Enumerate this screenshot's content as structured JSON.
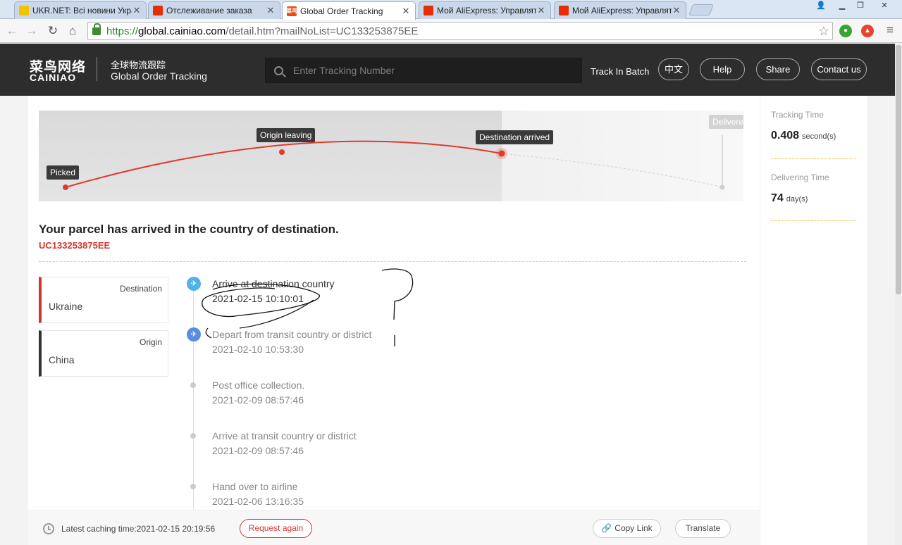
{
  "browser": {
    "tabs": [
      {
        "label": "UKR.NET: Всі новини Україн",
        "favicon_color": "#f4c300",
        "active": false
      },
      {
        "label": "Отслеживание заказа",
        "favicon_color": "#e62e04",
        "active": false
      },
      {
        "label": "Global Order Tracking",
        "favicon_color": "#e64a19",
        "favicon_text": "菜鸟",
        "active": true
      },
      {
        "label": "Мой AliExpress: Управлять",
        "favicon_color": "#e62e04",
        "active": false
      },
      {
        "label": "Мой AliExpress: Управлять",
        "favicon_color": "#e62e04",
        "active": false
      }
    ],
    "url_scheme": "https://",
    "url_host": "global.cainiao.com",
    "url_rest": "/detail.htm?mailNoList=UC133253875EE"
  },
  "header": {
    "logo_cn": "菜鸟网络",
    "logo_en": "CAINIAO",
    "subtitle_cn": "全球物流跟踪",
    "subtitle_en": "Global Order Tracking",
    "search_placeholder": "Enter Tracking Number",
    "track_in_batch": "Track In Batch",
    "lang_button": "中文",
    "help_button": "Help",
    "share_button": "Share",
    "contact_button": "Contact us"
  },
  "progress": {
    "stages": [
      "Picked",
      "Origin leaving",
      "Destination arrived",
      "Delivere"
    ],
    "current_stage": "Destination arrived",
    "accent": "#e03a2f"
  },
  "summary": {
    "title": "Your parcel has arrived in the country of destination.",
    "tracking_number": "UC133253875EE"
  },
  "route": {
    "destination_label": "Destination",
    "destination_value": "Ukraine",
    "origin_label": "Origin",
    "origin_value": "China"
  },
  "events": [
    {
      "desc": "Arrive at destination country",
      "time": "2021-02-15 10:10:01",
      "icon": "plane-landing-icon"
    },
    {
      "desc": "Depart from transit country or district",
      "time": "2021-02-10 10:53:30",
      "icon": "plane-takeoff-icon"
    },
    {
      "desc": "Post office collection.",
      "time": "2021-02-09 08:57:46",
      "icon": "dot"
    },
    {
      "desc": "Arrive at transit country or district",
      "time": "2021-02-09 08:57:46",
      "icon": "dot"
    },
    {
      "desc": "Hand over to airline",
      "time": "2021-02-06 13:16:35",
      "icon": "dot"
    }
  ],
  "footer": {
    "cache_text": "Latest caching time:2021-02-15 20:19:56",
    "request_again": "Request again",
    "copy_link": "Copy Link",
    "translate": "Translate"
  },
  "side": {
    "tracking_time_label": "Tracking Time",
    "tracking_time_value": "0.408",
    "tracking_time_unit": "second(s)",
    "delivering_time_label": "Delivering Time",
    "delivering_time_value": "74",
    "delivering_time_unit": "day(s)"
  }
}
